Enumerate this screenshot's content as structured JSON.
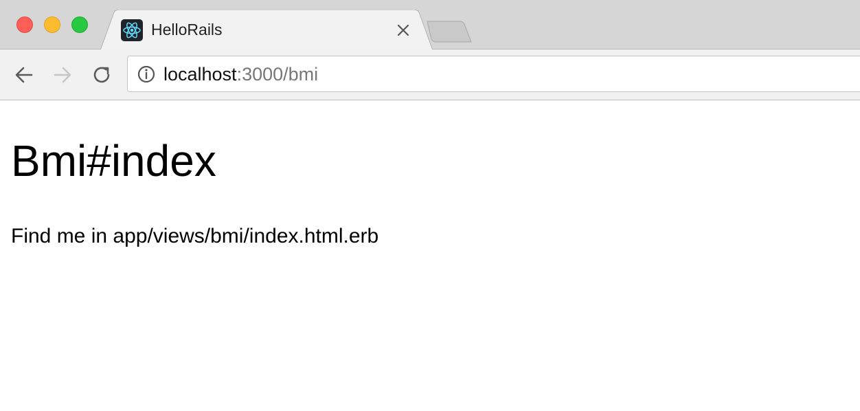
{
  "browser": {
    "tab": {
      "title": "HelloRails",
      "favicon": "react-atom-icon",
      "close_icon": "close-icon"
    },
    "omnibox": {
      "host": "localhost",
      "path": ":3000/bmi",
      "security_icon": "info-icon"
    },
    "nav": {
      "back_icon": "arrow-left-icon",
      "forward_icon": "arrow-right-icon",
      "reload_icon": "reload-icon"
    },
    "colors": {
      "close_button": "#fc5f57",
      "minimize_button": "#fdbc2e",
      "maximize_button": "#28c840",
      "favicon_accent": "#61dafb"
    }
  },
  "page": {
    "heading": "Bmi#index",
    "paragraph": "Find me in app/views/bmi/index.html.erb"
  }
}
